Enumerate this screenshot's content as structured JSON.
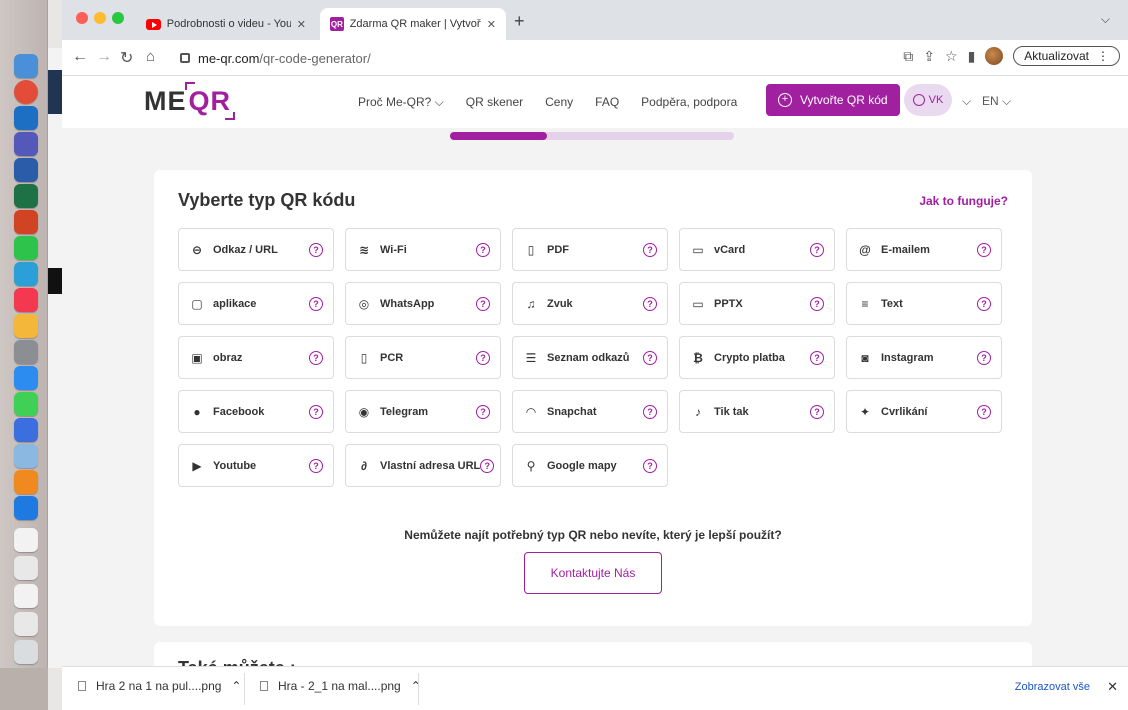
{
  "browser": {
    "tabs": [
      {
        "title": "Podrobnosti o videu - YouTube",
        "close": "✕"
      },
      {
        "title": "Zdarma QR maker | Vytvořte QR",
        "close": "✕"
      }
    ],
    "new_tab": "+",
    "url_domain": "me-qr.com",
    "url_path": "/qr-code-generator/",
    "update_label": "Aktualizovat"
  },
  "site": {
    "logo_me": "ME",
    "logo_qr": "QR",
    "menu": [
      "Proč Me-QR? ⌵",
      "QR skener",
      "Ceny",
      "FAQ",
      "Podpěra, podpora"
    ],
    "cta_label": "Vytvořte QR kód",
    "user_initials": "VK",
    "language": "EN",
    "progress_fraction": 0.34
  },
  "card": {
    "title": "Vyberte typ QR kódu",
    "howto": "Jak to funguje?",
    "types": [
      {
        "label": "Odkaz / URL",
        "icon": "link-icon"
      },
      {
        "label": "Wi-Fi",
        "icon": "wifi-icon"
      },
      {
        "label": "PDF",
        "icon": "pdf-icon"
      },
      {
        "label": "vCard",
        "icon": "vcard-icon"
      },
      {
        "label": "E-mailem",
        "icon": "at-icon"
      },
      {
        "label": "aplikace",
        "icon": "app-icon"
      },
      {
        "label": "WhatsApp",
        "icon": "whatsapp-icon"
      },
      {
        "label": "Zvuk",
        "icon": "music-icon"
      },
      {
        "label": "PPTX",
        "icon": "pptx-icon"
      },
      {
        "label": "Text",
        "icon": "text-icon"
      },
      {
        "label": "obraz",
        "icon": "image-icon"
      },
      {
        "label": "PCR",
        "icon": "document-icon"
      },
      {
        "label": "Seznam odkazů",
        "icon": "list-icon"
      },
      {
        "label": "Crypto platba",
        "icon": "bitcoin-icon"
      },
      {
        "label": "Instagram",
        "icon": "instagram-icon"
      },
      {
        "label": "Facebook",
        "icon": "facebook-icon"
      },
      {
        "label": "Telegram",
        "icon": "telegram-icon"
      },
      {
        "label": "Snapchat",
        "icon": "snapchat-icon"
      },
      {
        "label": "Tik tak",
        "icon": "tiktok-icon"
      },
      {
        "label": "Cvrlikání",
        "icon": "twitter-icon"
      },
      {
        "label": "Youtube",
        "icon": "youtube-icon"
      },
      {
        "label": "Vlastní adresa URL",
        "icon": "custom-link-icon"
      },
      {
        "label": "Google mapy",
        "icon": "map-pin-icon"
      }
    ],
    "help_glyph": "?",
    "note": "Nemůžete najít potřebný typ QR nebo nevíte, který je lepší použít?",
    "contact_label": "Kontaktujte Nás"
  },
  "card2": {
    "title": "Také můžete :"
  },
  "downloads": {
    "items": [
      "Hra 2 na 1 na pul....png",
      "Hra - 2_1 na mal....png"
    ],
    "show_all": "Zobrazovat vše",
    "close": "✕"
  },
  "colors": {
    "accent": "#a020a0"
  }
}
